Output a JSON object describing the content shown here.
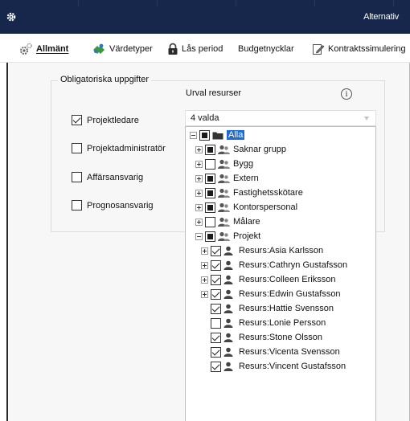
{
  "window": {
    "title": "Alternativ"
  },
  "toolbar": {
    "items": [
      {
        "label": "Allmänt",
        "icon": "gear-settings-icon"
      },
      {
        "label": "Värdetyper",
        "icon": "puzzle-users-icon"
      },
      {
        "label": "Lås period",
        "icon": "lock-icon"
      },
      {
        "label": "Budgetnycklar",
        "icon": ""
      },
      {
        "label": "Kontraktssimulering",
        "icon": "document-edit-icon"
      }
    ]
  },
  "form": {
    "group_title": "Obligatoriska uppgifter",
    "roles": [
      {
        "label": "Projektledare",
        "checked": true
      },
      {
        "label": "Projektadministratör",
        "checked": false
      },
      {
        "label": "Affärsansvarig",
        "checked": false
      },
      {
        "label": "Prognosansvarig",
        "checked": false
      }
    ],
    "urval_label": "Urval resurser",
    "info_symbol": "i",
    "combo_value": "4 valda"
  },
  "tree": {
    "root": {
      "label": "Alla",
      "state": "partial"
    },
    "groups": [
      {
        "label": "Saknar grupp",
        "state": "partial"
      },
      {
        "label": "Bygg",
        "state": "unchecked"
      },
      {
        "label": "Extern",
        "state": "partial"
      },
      {
        "label": "Fastighetsskötare",
        "state": "partial"
      },
      {
        "label": "Kontorspersonal",
        "state": "partial"
      },
      {
        "label": "Målare",
        "state": "unchecked"
      },
      {
        "label": "Projekt",
        "state": "partial"
      }
    ],
    "resources": [
      {
        "label": "Resurs:Asia Karlsson",
        "checked": true,
        "expandable": true
      },
      {
        "label": "Resurs:Cathryn Gustafsson",
        "checked": true,
        "expandable": true
      },
      {
        "label": "Resurs:Colleen Eriksson",
        "checked": true,
        "expandable": true
      },
      {
        "label": "Resurs:Edwin Gustafsson",
        "checked": true,
        "expandable": true
      },
      {
        "label": "Resurs:Hattie Svensson",
        "checked": true,
        "expandable": false
      },
      {
        "label": "Resurs:Lonie Persson",
        "checked": false,
        "expandable": false
      },
      {
        "label": "Resurs:Stone Olsson",
        "checked": true,
        "expandable": false
      },
      {
        "label": "Resurs:Vicenta Svensson",
        "checked": true,
        "expandable": false
      },
      {
        "label": "Resurs:Vincent Gustafsson",
        "checked": true,
        "expandable": false
      }
    ]
  },
  "colors": {
    "titlebar": "#16274b",
    "selection": "#1e6bd6",
    "panel": "#f7f7f7"
  }
}
